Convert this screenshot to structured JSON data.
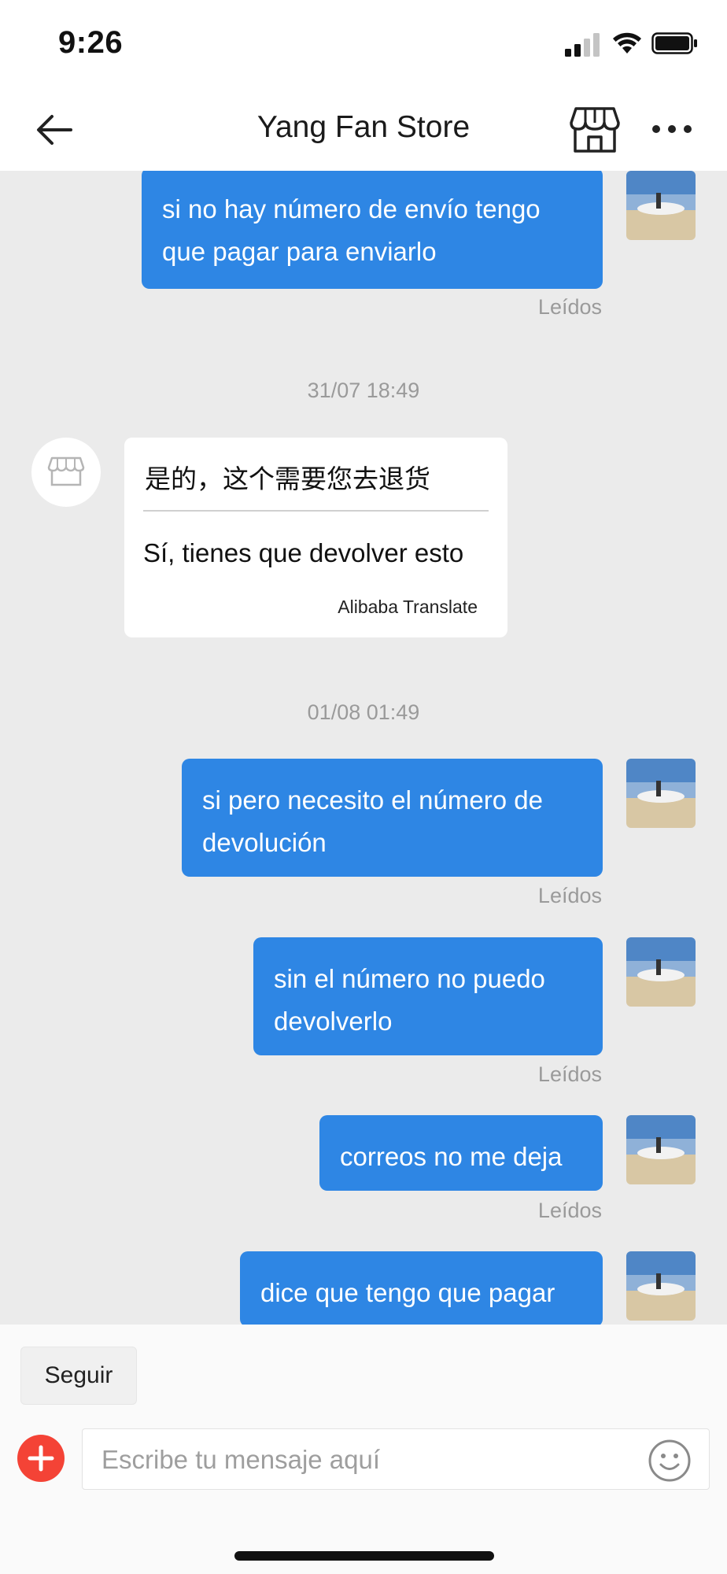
{
  "status_bar": {
    "time": "9:26",
    "icons": [
      "cellular-signal-icon",
      "wifi-icon",
      "battery-icon"
    ]
  },
  "nav": {
    "title": "Yang Fan Store",
    "back_icon": "arrow-left-icon",
    "store_icon": "storefront-icon",
    "more_icon": "more-horizontal-icon"
  },
  "messages": [
    {
      "direction": "out",
      "text": "si no hay número de envío tengo que pagar para enviarlo",
      "status": "Leídos"
    },
    {
      "type": "timestamp",
      "text": "31/07 18:49"
    },
    {
      "direction": "in",
      "original": "是的，这个需要您去退货",
      "translation": "Sí, tienes que devolver esto",
      "credit": "Alibaba Translate"
    },
    {
      "type": "timestamp",
      "text": "01/08 01:49"
    },
    {
      "direction": "out",
      "text": "si pero necesito el número de devolución",
      "status": "Leídos"
    },
    {
      "direction": "out",
      "text": "sin el número no puedo devolverlo",
      "status": "Leídos"
    },
    {
      "direction": "out",
      "text": "correos no me deja",
      "status": "Leídos"
    },
    {
      "direction": "out",
      "text": "dice que tengo que pagar"
    }
  ],
  "bottom": {
    "follow_label": "Seguir",
    "input_placeholder": "Escribe tu mensaje aquí",
    "plus_icon": "plus-circle-icon",
    "emoji_icon": "smiley-icon"
  },
  "colors": {
    "outgoing_bubble": "#2e86e4",
    "chat_background": "#ebebeb",
    "accent_red": "#f44336"
  }
}
